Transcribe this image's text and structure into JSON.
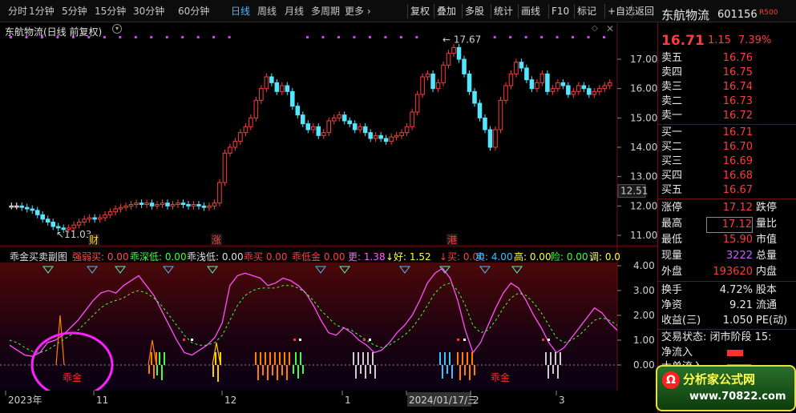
{
  "toolbar": {
    "tabs": [
      "分时",
      "1分钟",
      "5分钟",
      "15分钟",
      "30分钟",
      "60分钟",
      "日线",
      "周线",
      "月线",
      "多周期",
      "更多 ›"
    ],
    "active_tab": "日线",
    "buttons": [
      "复权",
      "叠加",
      "多股",
      "统计",
      "画线",
      "F10",
      "标记",
      "+自选",
      "返回"
    ]
  },
  "main_chart": {
    "title": "东航物流(日线 前复权)",
    "y_ticks": [
      "17.00",
      "16.00",
      "15.00",
      "14.00",
      "13.00",
      "12.00",
      "11.00"
    ],
    "current_price_tag": "12.51",
    "high_label": "17.67",
    "low_label": "11.03",
    "event_badges": [
      "财",
      "涨",
      "港"
    ],
    "colors": {
      "up": "#ff3b3b",
      "down": "#54e6ff",
      "flat": "#ffffff"
    }
  },
  "indicator": {
    "name": "乖金买卖副图",
    "items": [
      {
        "label": "强弱买:",
        "value": "0.00",
        "color": "#ff5050"
      },
      {
        "label": "乖深低:",
        "value": "0.00",
        "color": "#40ff40"
      },
      {
        "label": "乖浅低:",
        "value": "0.00",
        "color": "#e0e0e0"
      },
      {
        "label": "乖买",
        "value": "0.00",
        "color": "#ff4040"
      },
      {
        "label": "乖低金",
        "value": "0.00",
        "color": "#ff4040"
      },
      {
        "label": "更:",
        "value": "1.38",
        "color": "#ff60ff"
      },
      {
        "label": "↓好:",
        "value": "1.52",
        "color": "#ffff40"
      },
      {
        "label": "↓买:",
        "value": "0.00",
        "color": "#ff4040"
      },
      {
        "label": "卖:",
        "value": "4.00",
        "color": "#40c0ff"
      },
      {
        "label": "高:",
        "value": "0.00",
        "color": "#ffff40"
      },
      {
        "label": "险:",
        "value": "0.00",
        "color": "#40ff40"
      },
      {
        "label": "调:",
        "value": "0.0",
        "color": "#ffff40"
      }
    ],
    "y_ticks": [
      "4.00",
      "3.00",
      "2.00",
      "1.00",
      "0.00"
    ],
    "signal_labels": [
      "乖金",
      "乖金"
    ]
  },
  "time_axis": {
    "labels": [
      "2023年",
      "11",
      "12",
      "1",
      "2024/01/17/三",
      "2",
      "3"
    ]
  },
  "quote": {
    "stock_name": "东航物流",
    "stock_code": "601156",
    "badge": "R500",
    "price": "16.71",
    "change": "1.15",
    "change_pct": "7.39%",
    "asks": [
      {
        "label": "卖五",
        "price": "16.76"
      },
      {
        "label": "卖四",
        "price": "16.75"
      },
      {
        "label": "卖三",
        "price": "16.74"
      },
      {
        "label": "卖二",
        "price": "16.73"
      },
      {
        "label": "卖一",
        "price": "16.72"
      }
    ],
    "bids": [
      {
        "label": "买一",
        "price": "16.71"
      },
      {
        "label": "买二",
        "price": "16.70"
      },
      {
        "label": "买三",
        "price": "16.69"
      },
      {
        "label": "买四",
        "price": "16.68"
      },
      {
        "label": "买五",
        "price": "16.67"
      }
    ],
    "stats": [
      {
        "label": "涨停",
        "value": "17.12",
        "label2": "跌停"
      },
      {
        "label": "最高",
        "value": "17.12",
        "label2": "量比"
      },
      {
        "label": "最低",
        "value": "15.90",
        "label2": "市值"
      },
      {
        "label": "现量",
        "value": "3222",
        "label2": "总量"
      },
      {
        "label": "外盘",
        "value": "193620",
        "label2": "内盘"
      }
    ],
    "stats2": [
      {
        "label": "换手",
        "value": "4.72%",
        "label2": "股本"
      },
      {
        "label": "净资",
        "value": "9.21",
        "label2": "流通"
      },
      {
        "label": "收益(三)",
        "value": "1.050",
        "label2": "PE(动)"
      }
    ],
    "trade_status": "交易状态: 闭市阶段 15:",
    "flow": [
      {
        "label": "净流入"
      },
      {
        "label": "大单流入"
      }
    ]
  },
  "watermark": {
    "text": "分析家公式网",
    "url_text": "www.70822.com",
    "logo_title": "分析家公式网",
    "logo_url": "www.70822.com"
  }
}
